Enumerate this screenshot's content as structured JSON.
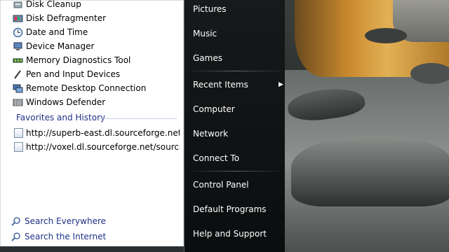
{
  "programs": [
    {
      "label": "Disk Cleanup",
      "icon": "disk-cleanup-icon"
    },
    {
      "label": "Disk Defragmenter",
      "icon": "disk-defragmenter-icon"
    },
    {
      "label": "Date and Time",
      "icon": "clock-icon"
    },
    {
      "label": "Device Manager",
      "icon": "device-manager-icon"
    },
    {
      "label": "Memory Diagnostics Tool",
      "icon": "memory-diagnostics-icon"
    },
    {
      "label": "Pen and Input Devices",
      "icon": "pen-icon"
    },
    {
      "label": "Remote Desktop Connection",
      "icon": "remote-desktop-icon"
    },
    {
      "label": "Windows Defender",
      "icon": "windows-defender-icon"
    }
  ],
  "favorites": {
    "title": "Favorites and History",
    "items": [
      {
        "label": "http://superb-east.dl.sourceforge.net/s...",
        "icon": "web-page-icon"
      },
      {
        "label": "http://voxel.dl.sourceforge.net/sourcef...",
        "icon": "web-page-icon"
      }
    ]
  },
  "search": {
    "everywhere": "Search Everywhere",
    "internet": "Search the Internet"
  },
  "right_menu": {
    "pictures": "Pictures",
    "music": "Music",
    "games": "Games",
    "recent_items": "Recent Items",
    "computer": "Computer",
    "network": "Network",
    "connect_to": "Connect To",
    "control_panel": "Control Panel",
    "default_programs": "Default Programs",
    "help_support": "Help and Support"
  },
  "colors": {
    "link_blue": "#1e3287",
    "menu_dark": "#141618",
    "wallpaper_gold": "#c98a2e"
  }
}
